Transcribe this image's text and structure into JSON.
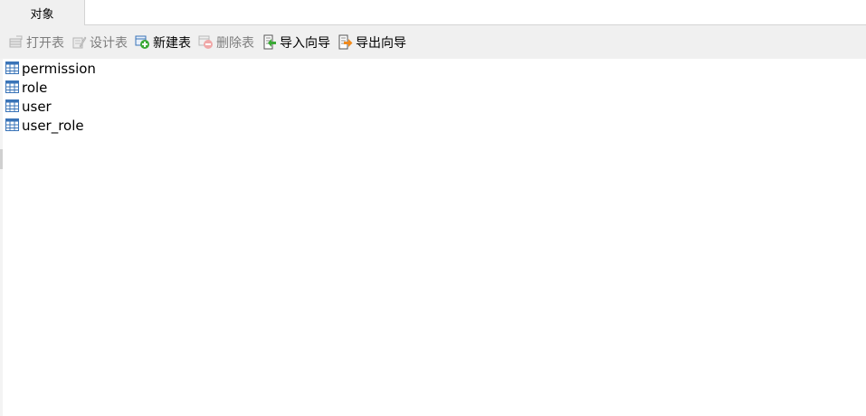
{
  "tabs": [
    {
      "label": "对象"
    }
  ],
  "toolbar": {
    "buttons": [
      {
        "label": "打开表",
        "icon": "open-table-icon",
        "enabled": false
      },
      {
        "label": "设计表",
        "icon": "design-table-icon",
        "enabled": false
      },
      {
        "label": "新建表",
        "icon": "new-table-icon",
        "enabled": true
      },
      {
        "label": "删除表",
        "icon": "delete-table-icon",
        "enabled": false
      },
      {
        "label": "导入向导",
        "icon": "import-wizard-icon",
        "enabled": true
      },
      {
        "label": "导出向导",
        "icon": "export-wizard-icon",
        "enabled": true
      }
    ]
  },
  "tables": [
    {
      "name": "permission",
      "icon": "table-icon"
    },
    {
      "name": "role",
      "icon": "table-icon"
    },
    {
      "name": "user",
      "icon": "table-icon"
    },
    {
      "name": "user_role",
      "icon": "table-icon"
    }
  ],
  "colors": {
    "toolbar_bg": "#f0f0f0",
    "disabled_text": "#7d7d7d",
    "table_icon_blue": "#3a74b8",
    "add_green": "#3aa935",
    "delete_red": "#e07070",
    "export_orange": "#f08a1c"
  }
}
